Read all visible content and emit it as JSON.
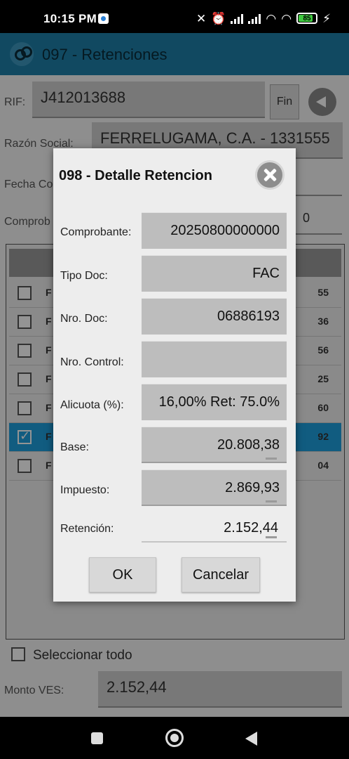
{
  "status_bar": {
    "time": "10:15 PM",
    "battery": "85",
    "battery_level_pct": 85,
    "icons": [
      "notification-icon",
      "mute-icon",
      "alarm-icon",
      "signal-icon",
      "signal-icon",
      "wifi-icon",
      "wifi-icon",
      "battery-icon",
      "charging-icon"
    ]
  },
  "app_bar": {
    "title": "097 - Retenciones",
    "logo_icon": "app-logo-icon"
  },
  "form": {
    "rif_label": "RIF:",
    "rif_value": "J412013688",
    "fin_label": "Fin",
    "razon_label": "Razón Social:",
    "razon_value": "FERRELUGAMA, C.A. - 1331555",
    "fecha_label": "Fecha Co",
    "comprob_label": "Comprob",
    "comprob_value_tail": "0"
  },
  "grid_rows": [
    {
      "first": "F",
      "last": "55",
      "selected": false
    },
    {
      "first": "F",
      "last": "36",
      "selected": false
    },
    {
      "first": "F",
      "last": "56",
      "selected": false
    },
    {
      "first": "F",
      "last": "25",
      "selected": false
    },
    {
      "first": "F",
      "last": "60",
      "selected": false
    },
    {
      "first": "F",
      "last": "92",
      "selected": true
    },
    {
      "first": "F",
      "last": "04",
      "selected": false
    }
  ],
  "select_all_label": "Seleccionar todo",
  "monto_label": "Monto VES:",
  "monto_value": "2.152,44",
  "dialog": {
    "title": "098 - Detalle Retencion",
    "comprobante_label": "Comprobante:",
    "comprobante_value": "20250800000000",
    "tipo_doc_label": "Tipo Doc:",
    "tipo_doc_value": "FAC",
    "nro_doc_label": "Nro. Doc:",
    "nro_doc_value": "06886193",
    "nro_control_label": "Nro. Control:",
    "nro_control_value": "",
    "alicuota_label": "Alicuota (%):",
    "alicuota_value": "16,00% Ret: 75.0%",
    "base_label": "Base:",
    "base_value": "20.808,38",
    "impuesto_label": "Impuesto:",
    "impuesto_value": "2.869,93",
    "retencion_label": "Retención:",
    "retencion_value": "2.152,44",
    "ok_label": "OK",
    "cancel_label": "Cancelar"
  },
  "colors": {
    "app_bar": "#1e7fa8",
    "selected_row": "#1e9fdc",
    "dialog_bg": "#ededed",
    "field_bg": "#bdbdbd"
  }
}
